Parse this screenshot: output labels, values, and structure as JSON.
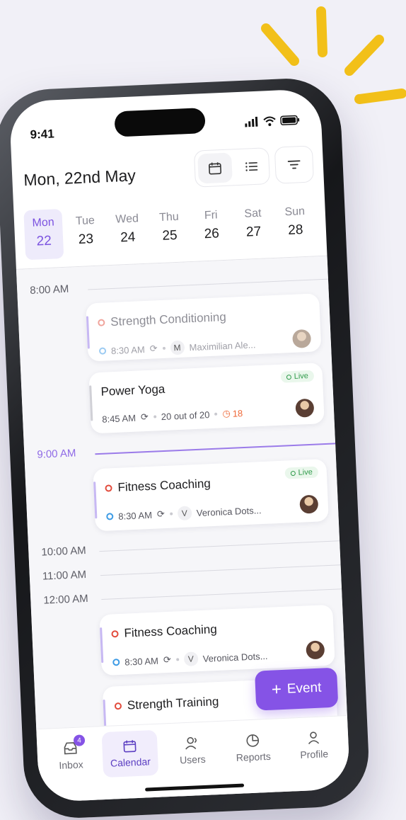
{
  "status": {
    "time": "9:41"
  },
  "header": {
    "title": "Mon, 22nd May"
  },
  "days": [
    {
      "name": "Mon",
      "num": "22"
    },
    {
      "name": "Tue",
      "num": "23"
    },
    {
      "name": "Wed",
      "num": "24"
    },
    {
      "name": "Thu",
      "num": "25"
    },
    {
      "name": "Fri",
      "num": "26"
    },
    {
      "name": "Sat",
      "num": "27"
    },
    {
      "name": "Sun",
      "num": "28"
    }
  ],
  "times": [
    "8:00 AM",
    "9:00 AM",
    "10:00 AM",
    "11:00 AM",
    "12:00 AM"
  ],
  "events": [
    {
      "title": "Strength Conditioning",
      "time": "8:30 AM",
      "initial": "M",
      "host": "Maximilian Ale..."
    },
    {
      "title": "Power Yoga",
      "time": "8:45 AM",
      "capacity": "20 out of 20",
      "waitlist": "18",
      "live": "Live"
    },
    {
      "title": "Fitness Coaching",
      "time": "8:30 AM",
      "initial": "V",
      "host": "Veronica Dots...",
      "live": "Live"
    },
    {
      "title": "Fitness Coaching",
      "time": "8:30 AM",
      "initial": "V",
      "host": "Veronica Dots..."
    },
    {
      "title": "Strength Training"
    }
  ],
  "fab": {
    "label": "Event"
  },
  "tabs": [
    {
      "label": "Inbox",
      "badge": "4"
    },
    {
      "label": "Calendar"
    },
    {
      "label": "Users"
    },
    {
      "label": "Reports"
    },
    {
      "label": "Profile"
    }
  ],
  "colors": {
    "accent": "#8553e6",
    "live": "#2f9a4a",
    "event_ring": "#e24b3c",
    "time_ring": "#3d9be5"
  }
}
